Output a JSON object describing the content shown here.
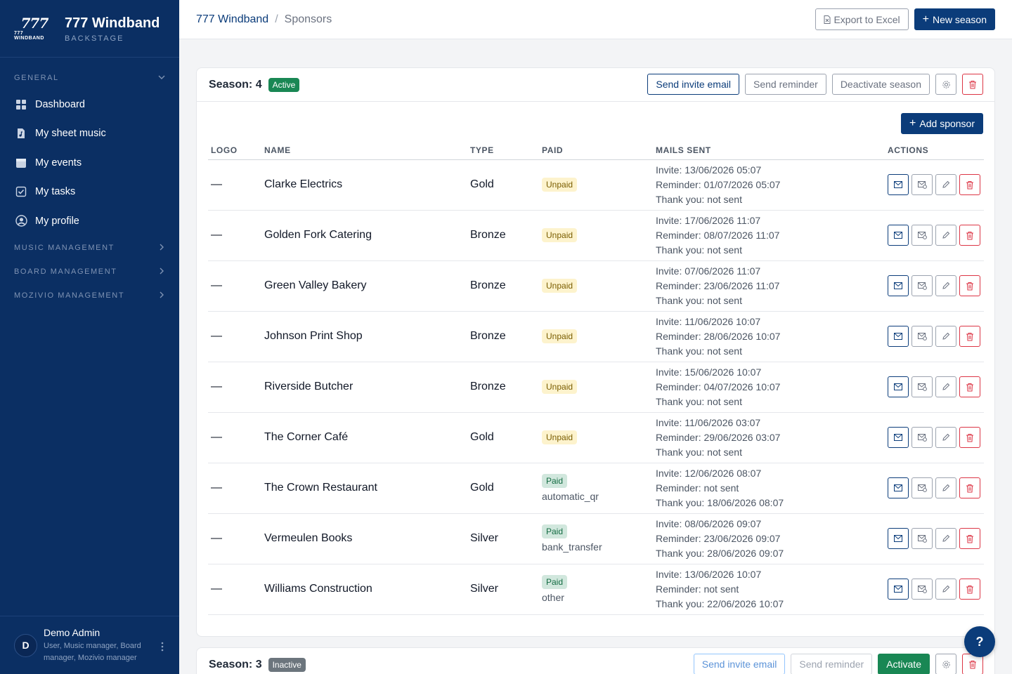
{
  "brand": {
    "logo_line1": "777",
    "logo_line2": "777 WINDBAND",
    "name": "777 Windband",
    "subtitle": "BACKSTAGE"
  },
  "sidebar": {
    "general_label": "GENERAL",
    "items": [
      {
        "label": "Dashboard",
        "icon": "dashboard-icon"
      },
      {
        "label": "My sheet music",
        "icon": "sheet-music-icon"
      },
      {
        "label": "My events",
        "icon": "calendar-icon"
      },
      {
        "label": "My tasks",
        "icon": "tasks-icon"
      },
      {
        "label": "My profile",
        "icon": "profile-icon"
      }
    ],
    "sections": [
      "MUSIC MANAGEMENT",
      "BOARD MANAGEMENT",
      "MOZIVIO MANAGEMENT"
    ]
  },
  "user": {
    "initial": "D",
    "name": "Demo Admin",
    "roles": "User, Music manager, Board manager, Mozivio manager"
  },
  "breadcrumb": {
    "home": "777 Windband",
    "separator": "/",
    "current": "Sponsors"
  },
  "toolbar": {
    "export_label": "Export to Excel",
    "new_season_label": "New season"
  },
  "season4": {
    "title": "Season: 4",
    "status": "Active",
    "send_invite": "Send invite email",
    "send_reminder": "Send reminder",
    "deactivate": "Deactivate season",
    "add_sponsor": "Add sponsor",
    "columns": [
      "LOGO",
      "NAME",
      "TYPE",
      "PAID",
      "MAILS SENT",
      "ACTIONS"
    ],
    "rows": [
      {
        "logo": "—",
        "name": "Clarke Electrics",
        "type": "Gold",
        "paid": "Unpaid",
        "method": "",
        "invite": "Invite: 13/06/2026 05:07",
        "reminder": "Reminder: 01/07/2026 05:07",
        "thanks": "Thank you: not sent"
      },
      {
        "logo": "—",
        "name": "Golden Fork Catering",
        "type": "Bronze",
        "paid": "Unpaid",
        "method": "",
        "invite": "Invite: 17/06/2026 11:07",
        "reminder": "Reminder: 08/07/2026 11:07",
        "thanks": "Thank you: not sent"
      },
      {
        "logo": "—",
        "name": "Green Valley Bakery",
        "type": "Bronze",
        "paid": "Unpaid",
        "method": "",
        "invite": "Invite: 07/06/2026 11:07",
        "reminder": "Reminder: 23/06/2026 11:07",
        "thanks": "Thank you: not sent"
      },
      {
        "logo": "—",
        "name": "Johnson Print Shop",
        "type": "Bronze",
        "paid": "Unpaid",
        "method": "",
        "invite": "Invite: 11/06/2026 10:07",
        "reminder": "Reminder: 28/06/2026 10:07",
        "thanks": "Thank you: not sent"
      },
      {
        "logo": "—",
        "name": "Riverside Butcher",
        "type": "Bronze",
        "paid": "Unpaid",
        "method": "",
        "invite": "Invite: 15/06/2026 10:07",
        "reminder": "Reminder: 04/07/2026 10:07",
        "thanks": "Thank you: not sent"
      },
      {
        "logo": "—",
        "name": "The Corner Café",
        "type": "Gold",
        "paid": "Unpaid",
        "method": "",
        "invite": "Invite: 11/06/2026 03:07",
        "reminder": "Reminder: 29/06/2026 03:07",
        "thanks": "Thank you: not sent"
      },
      {
        "logo": "—",
        "name": "The Crown Restaurant",
        "type": "Gold",
        "paid": "Paid",
        "method": "automatic_qr",
        "invite": "Invite: 12/06/2026 08:07",
        "reminder": "Reminder: not sent",
        "thanks": "Thank you: 18/06/2026 08:07"
      },
      {
        "logo": "—",
        "name": "Vermeulen Books",
        "type": "Silver",
        "paid": "Paid",
        "method": "bank_transfer",
        "invite": "Invite: 08/06/2026 09:07",
        "reminder": "Reminder: 23/06/2026 09:07",
        "thanks": "Thank you: 28/06/2026 09:07"
      },
      {
        "logo": "—",
        "name": "Williams Construction",
        "type": "Silver",
        "paid": "Paid",
        "method": "other",
        "invite": "Invite: 13/06/2026 10:07",
        "reminder": "Reminder: not sent",
        "thanks": "Thank you: 22/06/2026 10:07"
      }
    ]
  },
  "season3": {
    "title": "Season: 3",
    "status": "Inactive",
    "send_invite": "Send invite email",
    "send_reminder": "Send reminder",
    "activate": "Activate"
  },
  "help": {
    "label": "?"
  },
  "colors": {
    "sidebar": "#0b2f63",
    "primary": "#0b3c7a",
    "success": "#198754",
    "danger": "#dc3545"
  }
}
